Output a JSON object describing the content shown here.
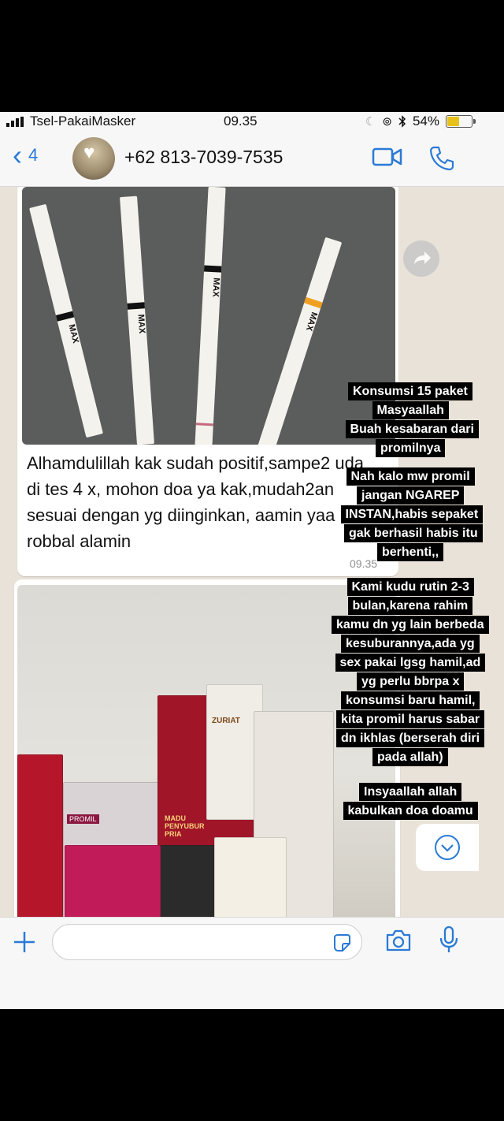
{
  "status_bar": {
    "carrier": "Tsel-PakaiMasker",
    "time": "09.35",
    "battery": "54%",
    "battery_level": 0.54,
    "accent_battery": "#e8c21a"
  },
  "header": {
    "back_count": "4",
    "contact_number": "+62 813-7039-7535",
    "accent": "#2a7ad6"
  },
  "messages": [
    {
      "type": "image",
      "strip_label": "MAX",
      "caption": "Alhamdulillah kak sudah positif,sampe2 uda di tes 4 x, mohon doa ya kak,mudah2an sesuai dengan yg diinginkan, aamin yaa robbal alamin",
      "time": "09.35"
    },
    {
      "type": "image",
      "product_labels": [
        "PROMIL",
        "MADU PENYUBUR PRIA",
        "ZURIAT"
      ]
    }
  ],
  "overlay_texts": [
    "Konsumsi 15 paket",
    "Masyaallah",
    "Buah kesabaran dari",
    "promilnya",
    "Nah kalo mw promil",
    "jangan NGAREP",
    "INSTAN,habis sepaket",
    "gak berhasil habis itu",
    "berhenti,,",
    "Kami kudu rutin 2-3",
    "bulan,karena rahim",
    "kamu dn yg lain berbeda",
    "kesuburannya,ada yg",
    "sex pakai lgsg hamil,ad",
    "yg perlu bbrpa x",
    "konsumsi baru hamil,",
    "kita promil harus sabar",
    "dn ikhlas (berserah diri",
    "pada allah)",
    "Insyaallah allah",
    "kabulkan doa doamu"
  ],
  "input_bar": {
    "placeholder": "",
    "icons": [
      "plus-icon",
      "sticker-icon",
      "camera-icon",
      "microphone-icon"
    ]
  }
}
